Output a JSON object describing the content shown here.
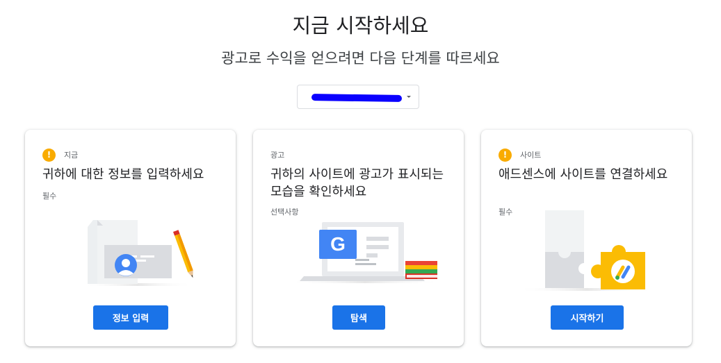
{
  "header": {
    "title": "지금 시작하세요",
    "subtitle": "광고로 수익을 얻으려면 다음 단계를 따르세요"
  },
  "site_select": {
    "value": ""
  },
  "cards": [
    {
      "tag": "지금",
      "title": "귀하에 대한 정보를 입력하세요",
      "requirement": "필수",
      "button": "정보 입력",
      "warning": true
    },
    {
      "tag": "광고",
      "title": "귀하의 사이트에 광고가 표시되는 모습을 확인하세요",
      "requirement": "선택사항",
      "button": "탐색",
      "warning": false
    },
    {
      "tag": "사이트",
      "title": "애드센스에 사이트를 연결하세요",
      "requirement": "필수",
      "button": "시작하기",
      "warning": true
    }
  ],
  "colors": {
    "primary": "#1a73e8",
    "warning": "#f9ab00",
    "redaction": "#0a00ff"
  },
  "icons": [
    "warning-icon",
    "id-card-illustration",
    "google-ad-preview-illustration",
    "puzzle-adsense-illustration",
    "dropdown-caret-icon"
  ]
}
